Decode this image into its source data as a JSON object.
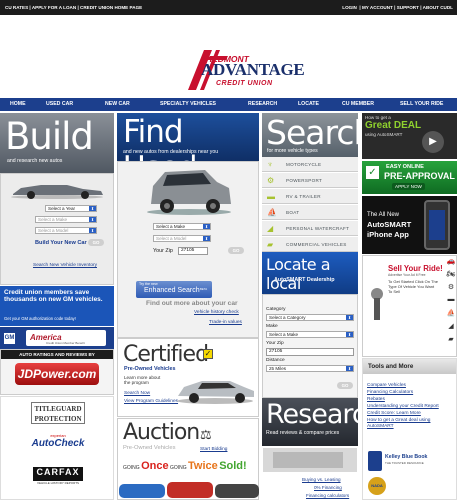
{
  "topbar": {
    "left": [
      "CU RATES",
      "APPLY FOR A LOAN",
      "CREDIT UNION HOME PAGE"
    ],
    "right": [
      "LOGIN",
      "MY ACCOUNT",
      "SUPPORT",
      "ABOUT CUDL"
    ],
    "sep": "|"
  },
  "logo": {
    "top": "PIEDMONT",
    "main": "ADVANTAGE",
    "bottom": "CREDIT UNION"
  },
  "nav": [
    "HOME",
    "USED CAR",
    "NEW CAR",
    "SPECIALTY VEHICLES",
    "RESEARCH",
    "LOCATE",
    "CU MEMBER",
    "SELL YOUR RIDE"
  ],
  "build": {
    "title": "Build",
    "subtitle": "and research new autos",
    "year_select": "Select a Year",
    "make_select": "Select a Make",
    "model_select": "Select a Model",
    "cta": "Build Your New Car",
    "go": "GO",
    "inventory_link": "Search New Vehicle Inventory"
  },
  "find": {
    "title": "Find Used",
    "subtitle": "and new autos from dealerships near you",
    "make_select": "Select a Make",
    "model_select": "Select a Model",
    "zip_label": "Your Zip",
    "zip_value": "27105",
    "go": "GO",
    "enh_try": "Try the new",
    "enh_label": "Enhanced Search",
    "enh_beta": "BETA",
    "more_text": "Find out more about your car",
    "history_link": "Vehicle history check",
    "trade_link": "Trade-in values"
  },
  "cu_promo": {
    "title": "Credit union members save thousands on new GM vehicles.",
    "sub": "Get your GM authorization code today!",
    "gm": "GM",
    "america1": "America",
    "america2": "Credit Union Member Benefit"
  },
  "jd": {
    "header": "AUTO RATINGS AND REVIEWS BY",
    "logo": "JDPower.com"
  },
  "partners": {
    "titleguard1": "TITLEGUARD",
    "titleguard2": "PROTECTION",
    "experian": "experian",
    "autocheck": "AutoCheck",
    "carfax": "CARFAX",
    "carfax_sub": "VEHICLE HISTORY REPORTS"
  },
  "certified": {
    "title": "Certified",
    "subtitle": "Pre-Owned Vehicles",
    "learn": "Learn more about the program",
    "search_link": "Search Now",
    "guide_link": "View Program Guidelines"
  },
  "auction": {
    "title": "Auction",
    "subtitle": "Pre-Owned Vehicles",
    "start_link": "Start Bidding",
    "going1": "GOING",
    "once": "Once",
    "going2": "GOING",
    "twice": "Twice",
    "sold": "Sold!"
  },
  "search": {
    "title": "Search",
    "subtitle": "for more vehicle types",
    "types": [
      "MOTORCYCLE",
      "POWERSPORT",
      "RV & TRAILER",
      "BOAT",
      "PERSONAL WATERCRAFT",
      "COMMERCIAL VEHICLES"
    ]
  },
  "locate": {
    "title": "Locate a local",
    "subtitle": "AutoSMART Dealership",
    "category_label": "Category",
    "category_select": "Select a Category",
    "make_label": "Make",
    "make_select": "Select a Make",
    "zip_label": "Your Zip",
    "zip_value": "27105",
    "distance_label": "Distance",
    "distance_select": "25 Miles",
    "go": "GO"
  },
  "research": {
    "title": "Research",
    "subtitle": "Read reviews & compare prices",
    "links": [
      "Buying vs. Leasing",
      "0% Financing",
      "Financing calculators"
    ]
  },
  "right": {
    "great1": "How to get a",
    "great2": "Great DEAL",
    "great3": "using AutoSMART",
    "apply1": "EASY ONLINE",
    "apply2": "PRE-APPROVAL",
    "apply3": "APPLY NOW",
    "iphone1": "The All New",
    "iphone2": "AutoSMART",
    "iphone3": "iPhone App",
    "sell_title": "Sell Your Ride!",
    "sell_sub": "Advertise Your Ad It Free",
    "sell_body": "To Get Started Click On The Type Of Vehicle You Want To Sell",
    "tools_title": "Tools and More",
    "tools_links": [
      "Compare Vehicles",
      "Financing Calculators",
      "Rebates",
      "Understanding your Credit Report",
      "Credit Score: Learn More",
      "How to get a Great deal using AutoSMART"
    ],
    "kbb1": "Kelley Blue Book",
    "kbb2": "THE TRUSTED RESOURCE",
    "nada": "NADA"
  }
}
